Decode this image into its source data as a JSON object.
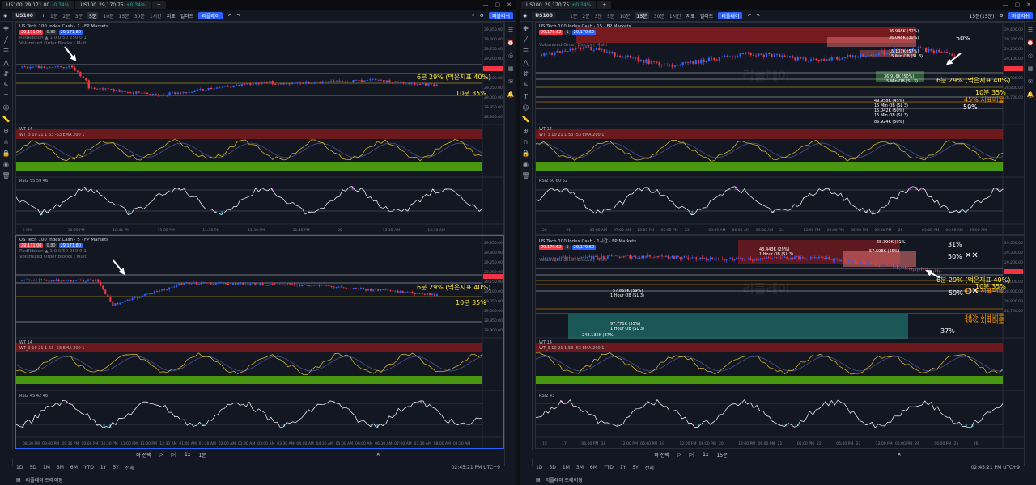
{
  "left": {
    "tabs": [
      {
        "symbol": "US100",
        "price": "29,171.00",
        "change": "-0.34%"
      },
      {
        "symbol": "US100",
        "price": "29,170.75",
        "change": "+0.34%"
      }
    ],
    "toolbar": {
      "symbol": "US100",
      "timeframes": [
        "1분",
        "2분",
        "3분",
        "5분",
        "10분",
        "15분",
        "30분",
        "1시간"
      ],
      "active_tf": "1분",
      "indicators": "지표",
      "alert": "얼러트",
      "replay": "리플레이",
      "publish": "퍼블리쉬"
    },
    "chart1": {
      "legend": "US Tech 100 Index Cash · 1 · FP Markets",
      "sell": "29,171.00",
      "spread": "0.80",
      "buy": "29,171.80",
      "sub1": "RedRibbon ▲ 1 0.0 50 250 0.1",
      "sub2": "Volumized Order Blocks | Multi",
      "ann1": "6분 29% (먹은지표 40%)",
      "ann2": "10분 35%",
      "price_axis": [
        "29,350.00",
        "29,300.00",
        "29,250.00",
        "29,200.00",
        "29,150.00",
        "29,100.00",
        "29,050.00",
        "29,000.00",
        "28,950.00",
        "28,900.00"
      ],
      "time_axis": [
        "5 PM",
        "10:30 PM",
        "10:45 PM",
        "11:00 PM",
        "11:15 PM",
        "11:30 PM",
        "11:45 PM",
        "25",
        "12:15 AM",
        "12:30 AM"
      ],
      "wt": "WT 14",
      "wt_sub": "WT_3 10 21 1 53 -53 EMA 200 1",
      "wt_axis": [
        "60.00",
        "40.00",
        "20.00",
        "-20.00",
        "-40.00",
        "-60.00"
      ],
      "rsi": "RSI2 55 59 46",
      "rsi_axis": [
        "80",
        "70",
        "50",
        "30",
        "20"
      ]
    },
    "chart2": {
      "legend": "US Tech 100 Index Cash · 5 · FP Markets",
      "sell": "29,171.00",
      "spread": "0.80",
      "buy": "29,171.80",
      "sub1": "RedRibbon ▲ 1 0.0 50 250 0.1",
      "sub2": "Volumized Order Blocks | Multi",
      "ann1": "6분 29% (먹은지표 40%)",
      "ann2": "10분 35%",
      "price_axis": [
        "29,350.00",
        "29,300.00",
        "29,250.00",
        "29,200.00",
        "29,150.00",
        "29,100.00",
        "29,050.00",
        "29,000.00",
        "28,950.00",
        "28,900.00"
      ],
      "time_axis": [
        "08:30 PM",
        "09:00 PM",
        "09:30 PM",
        "10:00 PM",
        "10:30 PM",
        "11:00 PM",
        "11:30 PM",
        "12:30 AM",
        "01:00 AM",
        "01:30 AM",
        "02:00 AM",
        "02:30 AM",
        "03:00 AM",
        "03:30 AM",
        "04:00 AM",
        "04:30 AM",
        "05:00 AM",
        "06:00 AM",
        "06:30 AM",
        "07:00 AM",
        "07:30 AM",
        "08:00 AM",
        "08:30 AM"
      ],
      "wt": "WT 14",
      "wt_sub": "WT_3 10 21 1 53 -53 EMA 200 1",
      "rsi": "RSI2 45 42 46"
    },
    "bottom_ranges": [
      "1D",
      "5D",
      "1M",
      "3M",
      "6M",
      "YTD",
      "1Y",
      "5Y",
      "전체"
    ],
    "clock": "02:45:21 PM UTC+9",
    "replay": {
      "select": "바 선택",
      "speed": "1x",
      "tf": "1분"
    },
    "footer": "리플레이 트레이딩"
  },
  "right": {
    "tabs": [
      {
        "symbol": "US100",
        "price": "29,170.75",
        "change": "+0.34%"
      }
    ],
    "toolbar": {
      "symbol": "US100",
      "timeframes": [
        "1분",
        "2분",
        "3분",
        "5분",
        "10분",
        "15분",
        "30분",
        "1시간"
      ],
      "active_tf": "15분",
      "indicators": "지표",
      "alert": "얼러트",
      "replay": "리플레이",
      "publish": "퍼블리쉬",
      "tf_sel": "15분(15분)"
    },
    "chart3": {
      "legend": "US Tech 100 Index Cash · 15 · FP Markets",
      "sell": "29,179.62",
      "spread": "1",
      "buy": "29,179.62",
      "sub": "Volumized Order Blocks | Multi",
      "ann_50": "50%",
      "ann1": "6분 29% (먹은지표 40%)",
      "ann2": "10분 35%",
      "ann3": "45% 지표매물",
      "ann4": "59%",
      "ob_labels": [
        "36.948K (32%)",
        "36.048K (30%)",
        "15.101K (57%)",
        "15 Min OB (SL 3)",
        "36.916K (50%)",
        "15 Min OB (SL 3)",
        "49.958K (45%)",
        "15 Min OB (SL 3)",
        "15.042K (50%)",
        "15 Min OB (SL 3)",
        "86.924K (50%)"
      ],
      "price_axis": [
        "29,400.00",
        "29,300.00",
        "29,200.00",
        "29,100.00",
        "29,000.00",
        "28,900.00",
        "28,800.00",
        "28,700.00"
      ],
      "time_axis": [
        "20",
        "21",
        "03:00 AM",
        "07:00 AM",
        "12:00 PM",
        "06:00 PM",
        "23",
        "03:00 AM",
        "06:00 AM",
        "09:00 AM",
        "24",
        "12:00 PM",
        "03:00 PM",
        "06:00 PM",
        "09:00 PM",
        "25",
        "03:00 AM",
        "06:00 AM",
        "09:00 AM"
      ],
      "wt": "WT 14",
      "wt_sub": "WT_3 10 21 1 53 -53 EMA 200 1",
      "rsi": "RSI2 50 60 52",
      "watermark": "리플레이"
    },
    "chart4": {
      "legend": "US Tech 100 Index Cash · 1시간 · FP Markets",
      "sell": "29,179.62",
      "spread": "1",
      "buy": "29,179.62",
      "sub": "Volumized Order Blocks | Multi",
      "ann_31": "31%",
      "ann_50": "50%",
      "ann1": "6분 29% (먹은지표 40%)",
      "ann2": "10분 35%",
      "ann3": "45% 지표매물",
      "ann_59": "59%",
      "ann4": "34% 지표매물",
      "ann5": "39% 지표매물",
      "ann_37": "37%",
      "ob_labels": [
        "43.443K (29%)",
        "1 Hour OB (SL 3)",
        "57.869K (59%)",
        "1 Hour OB (SL 3)",
        "97.771K (35%)",
        "1 Hour OB (SL 3)",
        "243.135K (37%)",
        "65.390K (31%)",
        "57.598K (45%)"
      ],
      "time_axis": [
        "15",
        "17",
        "06:00 PM",
        "18",
        "12:00 PM",
        "06:00 PM",
        "19",
        "12:00 PM",
        "06:00 PM",
        "20",
        "12:00 PM",
        "06:00 PM",
        "21",
        "06:00 PM",
        "22",
        "06:00 PM",
        "23",
        "12:00 PM",
        "06:00 PM",
        "24",
        "06:00 PM",
        "25",
        "26"
      ],
      "wt": "WT 14",
      "wt_sub": "WT_3 10 21 1 53 -53 EMA 200 1",
      "rsi": "RSI2 43",
      "watermark": "리플레이"
    },
    "bottom_ranges": [
      "1D",
      "5D",
      "1M",
      "3M",
      "6M",
      "YTD",
      "1Y",
      "5Y",
      "전체"
    ],
    "clock": "02:45:21 PM UTC+9",
    "replay": {
      "select": "바 선택",
      "speed": "1x",
      "tf": "15분"
    },
    "footer": "리플레이 트레이딩"
  },
  "colors": {
    "bg": "#131722",
    "up": "#2962ff",
    "down": "#f23645",
    "accent": "#2962ff",
    "ann_yellow": "#ffeb3b",
    "ann_orange": "#ff9800",
    "wt_red": "#b71c1c",
    "wt_green": "#76ff03",
    "rsi_purple": "#e040fb",
    "rsi_blue": "#29b6f6"
  }
}
